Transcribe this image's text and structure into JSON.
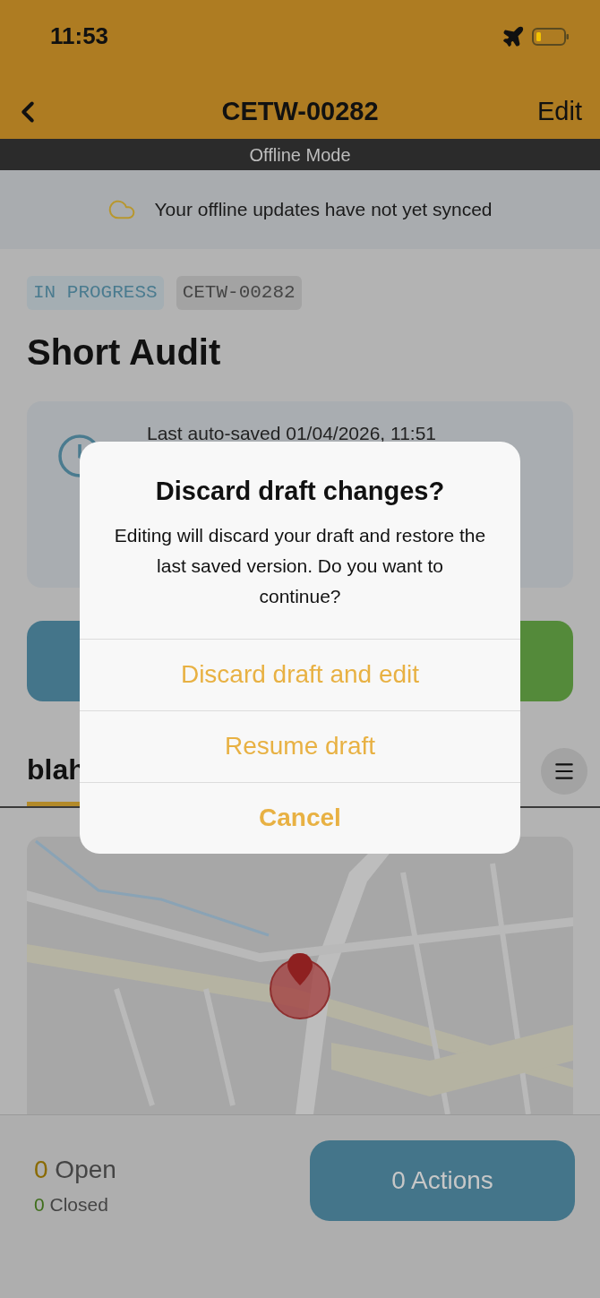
{
  "status_bar": {
    "time": "11:53"
  },
  "nav": {
    "title": "CETW-00282",
    "action": "Edit"
  },
  "offline_bar": {
    "text": "Offline Mode"
  },
  "sync_banner": {
    "text": "Your offline updates have not yet synced"
  },
  "tags": [
    {
      "label": "IN PROGRESS",
      "kind": "status"
    },
    {
      "label": "CETW-00282",
      "kind": "id"
    }
  ],
  "title": "Short Audit",
  "autosave_card": {
    "text": "Last auto-saved 01/04/2026, 11:51"
  },
  "tabs": [
    {
      "label": "blah",
      "selected": true
    }
  ],
  "summary": {
    "open_count": "0",
    "open_label": "Open",
    "closed_count": "0",
    "closed_label": "Closed",
    "actions_button": "0 Actions"
  },
  "dialog": {
    "title": "Discard draft changes?",
    "message": "Editing will discard your draft and restore the last saved version. Do you want to continue?",
    "buttons": [
      {
        "label": "Discard draft and edit",
        "kind": "default"
      },
      {
        "label": "Resume draft",
        "kind": "default"
      },
      {
        "label": "Cancel",
        "kind": "cancel"
      }
    ]
  }
}
